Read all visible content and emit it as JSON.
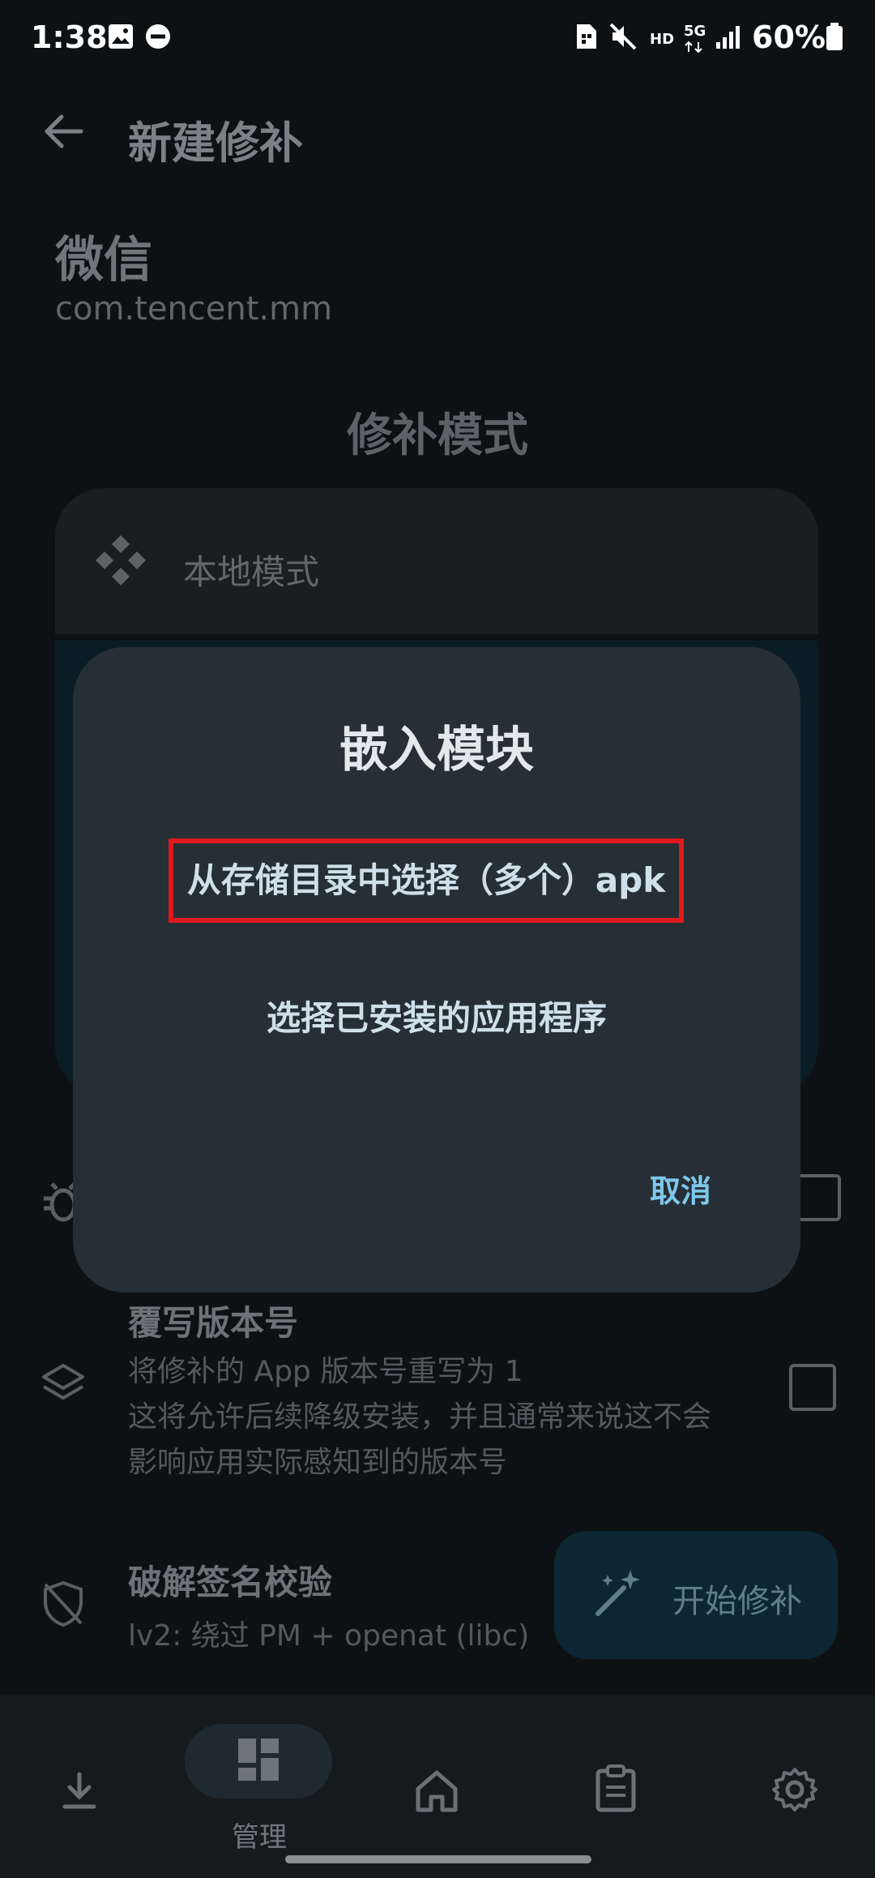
{
  "status_bar": {
    "time": "1:38",
    "battery": "60%",
    "network": "5G",
    "hd": "HD"
  },
  "header": {
    "title": "新建修补"
  },
  "app": {
    "name": "微信",
    "package": "com.tencent.mm"
  },
  "patch_mode": {
    "section_title": "修补模式",
    "selected_mode": "本地模式"
  },
  "options": {
    "override_version": {
      "title": "覆写版本号",
      "desc_line1": "将修补的 App 版本号重写为 1",
      "desc_line2": "这将允许后续降级安装，并且通常来说这不会",
      "desc_line3": "影响应用实际感知到的版本号"
    },
    "sig_bypass": {
      "title": "破解签名校验",
      "desc": "lv2: 绕过 PM + openat (libc)"
    }
  },
  "fab": {
    "label": "开始修补"
  },
  "bottom_nav": {
    "active_label": "管理"
  },
  "dialog": {
    "title": "嵌入模块",
    "option_storage": "从存储目录中选择（多个）apk",
    "option_installed": "选择已安装的应用程序",
    "cancel": "取消"
  },
  "colors": {
    "highlight_border": "#e0191e",
    "dialog_bg": "#252f35",
    "accent_text": "#7fc8ec"
  }
}
